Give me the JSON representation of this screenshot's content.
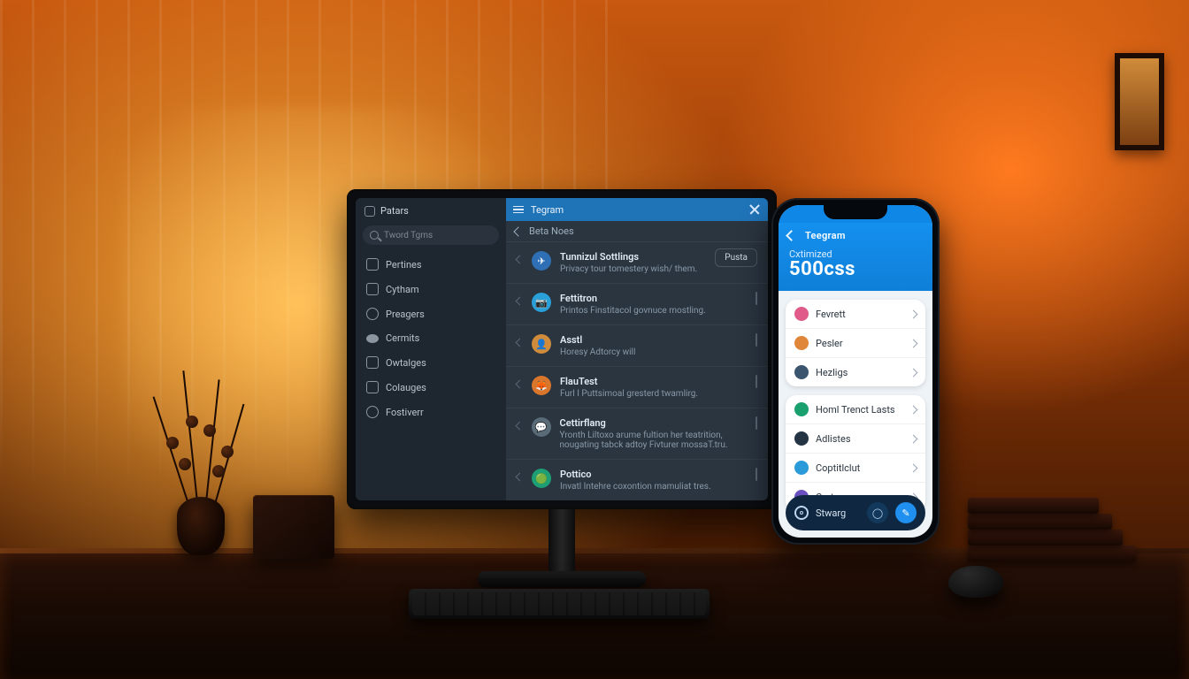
{
  "desktop": {
    "titlebar": {
      "app_name": "Tegram"
    },
    "subbar": {
      "section": "Beta Noes"
    },
    "sidebar": {
      "top_label": "Patars",
      "search_placeholder": "Tword Tgms",
      "items": [
        {
          "icon": "box-icon",
          "label": "Pertines"
        },
        {
          "icon": "gear-icon",
          "label": "Cytham"
        },
        {
          "icon": "circle-icon",
          "label": "Preagers"
        },
        {
          "icon": "dot-icon",
          "label": "Cermits"
        },
        {
          "icon": "box-icon",
          "label": "Owtalges"
        },
        {
          "icon": "box-icon",
          "label": "Colauges"
        },
        {
          "icon": "circle-icon",
          "label": "Fostiverr"
        }
      ]
    },
    "rows": [
      {
        "avatar_bg": "#2e6fb5",
        "glyph": "✈",
        "title": "Tunnizul Sottlings",
        "subtitle": "Privacy tour tomestery wish/ them.",
        "action": "Pusta"
      },
      {
        "avatar_bg": "#2aa0d8",
        "glyph": "📷",
        "title": "Fettitron",
        "subtitle": "Printos Finstitacol govnuce mostling."
      },
      {
        "avatar_bg": "#d08c3b",
        "glyph": "👤",
        "title": "Asstl",
        "subtitle": "Horesy Adtorcy will"
      },
      {
        "avatar_bg": "#d9762c",
        "glyph": "🦊",
        "title": "FlauTest",
        "subtitle": "Furl I Puttsimoal gresterd twamlirg."
      },
      {
        "avatar_bg": "#5a6b78",
        "glyph": "💬",
        "title": "Cettirflang",
        "subtitle": "Yronth Liltoxo arume fultion her teatrition, nougating tabck adtoy Fivturer mossaT.tru."
      },
      {
        "avatar_bg": "#1e9e74",
        "glyph": "🟢",
        "title": "Pottico",
        "subtitle": "Invatl Intehre coxontion mamuliat tres."
      }
    ]
  },
  "phone": {
    "header": {
      "title": "Teegram",
      "subtitle": "Cxtimized",
      "big_value": "500css"
    },
    "list1": [
      {
        "color": "#e05a8a",
        "label": "Fevrett"
      },
      {
        "color": "#e0863a",
        "label": "Pesler"
      },
      {
        "color": "#3b556e",
        "label": "Hezligs"
      }
    ],
    "list2": [
      {
        "color": "#1aa06f",
        "label": "Homl Trenct Lasts"
      },
      {
        "color": "#243444",
        "label": "Adlistes"
      },
      {
        "color": "#2a9bd8",
        "label": "Coptitlclut"
      },
      {
        "color": "#6a4fc0",
        "label": "Certruges"
      }
    ],
    "bottom": {
      "icon_label": "Stwarg"
    }
  }
}
